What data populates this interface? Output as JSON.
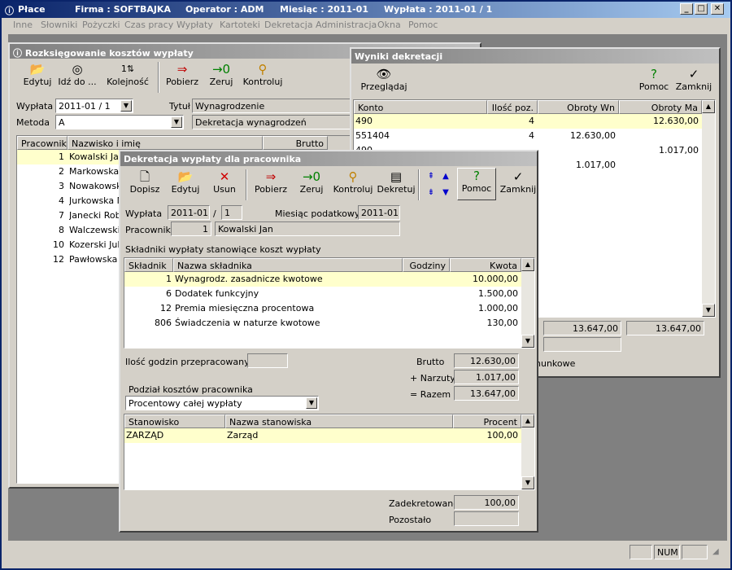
{
  "app": {
    "title_app": "Płace",
    "title_firm": "Firma : SOFTBAJKA",
    "title_operator": "Operator : ADM",
    "title_month": "Miesiąc : 2011-01",
    "title_payout": "Wypłata : 2011-01 /  1",
    "btn_min": "_",
    "btn_max": "□",
    "btn_close": "✕"
  },
  "menu": [
    "Inne",
    "Słowniki",
    "Pożyczki",
    "Czas pracy",
    "Wypłaty",
    "Kartoteki",
    "Dekretacja",
    "Administracja",
    "Okna",
    "Pomoc"
  ],
  "rozks": {
    "title": "Rozksięgowanie kosztów wypłaty",
    "toolbar": {
      "edytuj": "Edytuj",
      "idz": "Idź do ...",
      "kolejnosc": "Kolejność",
      "pobierz": "Pobierz",
      "zeruj": "Zeruj",
      "kontroluj": "Kontroluj"
    },
    "wyplata_label": "Wypłata",
    "wyplata_value": "2011-01 /  1",
    "tytul_label": "Tytuł",
    "tytul_value": "Wynagrodzenie",
    "metoda_label": "Metoda",
    "metoda_value": "A",
    "metoda_desc": "Dekretacja wynagrodzeń",
    "columns": [
      "Pracownik",
      "Nazwisko i imię",
      "Brutto"
    ],
    "rows": [
      {
        "nr": "1",
        "name": "Kowalski Jan"
      },
      {
        "nr": "2",
        "name": "Markowska I"
      },
      {
        "nr": "3",
        "name": "Nowakowski"
      },
      {
        "nr": "4",
        "name": "Jurkowska M"
      },
      {
        "nr": "7",
        "name": "Janecki Robe"
      },
      {
        "nr": "8",
        "name": "Walczewski T"
      },
      {
        "nr": "10",
        "name": "Kozerski Juliu"
      },
      {
        "nr": "12",
        "name": "Pawłowska J"
      }
    ]
  },
  "wyniki": {
    "title": "Wyniki dekretacji",
    "przegladaj": "Przeglądaj",
    "pomoc": "Pomoc",
    "zamknij": "Zamknij",
    "columns": [
      "Konto",
      "Ilość poz.",
      "Obroty Wn",
      "Obroty Ma"
    ],
    "rows": [
      {
        "konto": "490",
        "ilosc": "4",
        "wn": "",
        "ma": "12.630,00"
      },
      {
        "konto": "551404",
        "ilosc": "4",
        "wn": "12.630,00",
        "ma": ""
      },
      {
        "konto": "490",
        "ilosc": "",
        "wn": "",
        "ma": "1.017,00"
      },
      {
        "konto": "",
        "ilosc": "",
        "wn": "1.017,00",
        "ma": ""
      }
    ],
    "sum_wn": "13.647,00",
    "sum_ma": "13.647,00",
    "footer_text": "hunkowe"
  },
  "dekr": {
    "title": "Dekretacja wypłaty dla pracownika",
    "toolbar": {
      "dopisz": "Dopisz",
      "edytuj": "Edytuj",
      "usun": "Usun",
      "pobierz": "Pobierz",
      "zeruj": "Zeruj",
      "kontroluj": "Kontroluj",
      "dekretuj": "Dekretuj",
      "pomoc": "Pomoc",
      "zamknij": "Zamknij"
    },
    "wyplata_label": "Wypłata",
    "wyplata_value": "2011-01",
    "slash": "/",
    "wyplata_nr": "1",
    "miesiac_label": "Miesiąc podatkowy",
    "miesiac_value": "2011-01",
    "pracownik_label": "Pracownik",
    "pracownik_nr": "1",
    "pracownik_name": "Kowalski Jan",
    "skladniki_caption": "Składniki wypłaty stanowiące koszt wypłaty",
    "skl_columns": [
      "Składnik",
      "Nazwa składnika",
      "Godziny",
      "Kwota"
    ],
    "skl_rows": [
      {
        "nr": "1",
        "name": "Wynagrodz. zasadnicze kwotowe",
        "godz": "",
        "kwota": "10.000,00"
      },
      {
        "nr": "6",
        "name": "Dodatek funkcyjny",
        "godz": "",
        "kwota": "1.500,00"
      },
      {
        "nr": "12",
        "name": "Premia miesięczna procentowa",
        "godz": "",
        "kwota": "1.000,00"
      },
      {
        "nr": "806",
        "name": "Świadczenia w naturze kwotowe",
        "godz": "",
        "kwota": "130,00"
      }
    ],
    "godziny_label": "Ilość godzin przepracowanych",
    "godziny_value": "",
    "brutto_label": "Brutto",
    "brutto_value": "12.630,00",
    "narzuty_label": "+ Narzuty",
    "narzuty_value": "1.017,00",
    "razem_label": "= Razem",
    "razem_value": "13.647,00",
    "podzial_label": "Podział kosztów pracownika",
    "podzial_value": "Procentowy całej wypłaty",
    "st_columns": [
      "Stanowisko",
      "Nazwa stanowiska",
      "Procent"
    ],
    "st_rows": [
      {
        "code": "ZARZĄD",
        "name": "Zarząd",
        "pct": "100,00"
      }
    ],
    "zadekretowano_label": "Zadekretowano",
    "zadekretowano_value": "100,00",
    "pozostalo_label": "Pozostało",
    "pozostalo_value": ""
  },
  "status": {
    "num": "NUM"
  }
}
